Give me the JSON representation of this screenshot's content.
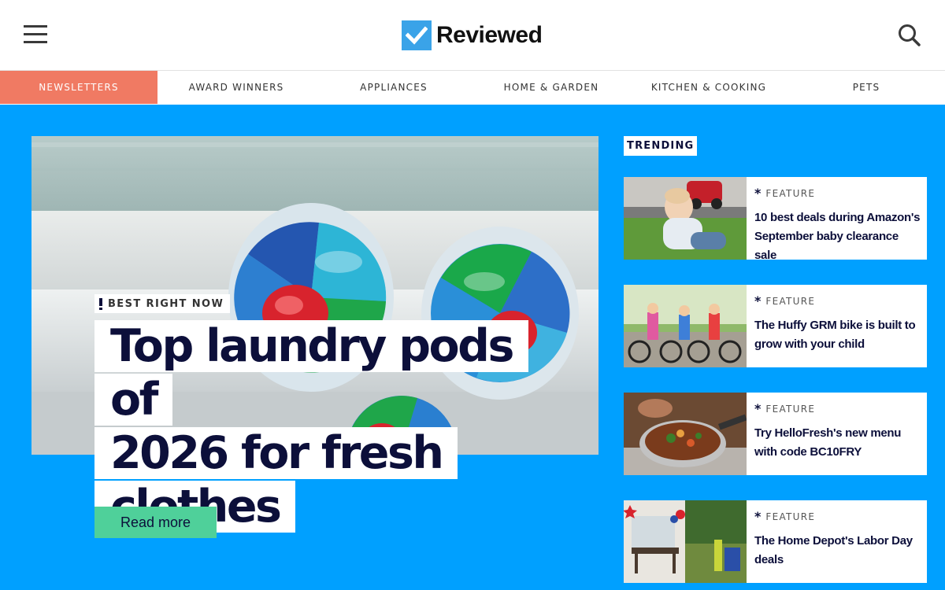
{
  "header": {
    "logo_text": "Reviewed",
    "logo_color": "#3aa3e8",
    "menu_icon": "hamburger-menu-icon",
    "search_icon": "search-icon"
  },
  "nav": {
    "items": [
      {
        "label": "NEWSLETTERS",
        "active": true
      },
      {
        "label": "AWARD WINNERS"
      },
      {
        "label": "APPLIANCES"
      },
      {
        "label": "HOME & GARDEN"
      },
      {
        "label": "KITCHEN & COOKING"
      },
      {
        "label": "PETS"
      }
    ],
    "active_color": "#f07a63"
  },
  "hero": {
    "badge": "BEST RIGHT NOW",
    "title": "Top laundry pods of 2026 for fresh clothes",
    "title_lines": [
      "Top laundry pods of",
      "2026 for fresh",
      "clothes"
    ],
    "button_label": "Read more",
    "button_color": "#4fd09a"
  },
  "trending": {
    "label": "TRENDING",
    "items": [
      {
        "tag": "FEATURE",
        "title": "10 best deals during Amazon's September baby clearance sale"
      },
      {
        "tag": "FEATURE",
        "title": "The Huffy GRM bike is built to grow with your child"
      },
      {
        "tag": "FEATURE",
        "title": "Try HelloFresh's new menu with code BC10FRY"
      },
      {
        "tag": "FEATURE",
        "title": "The Home Depot's Labor Day deals"
      }
    ]
  },
  "colors": {
    "background": "#00a0ff",
    "navy": "#0c0f3a"
  }
}
